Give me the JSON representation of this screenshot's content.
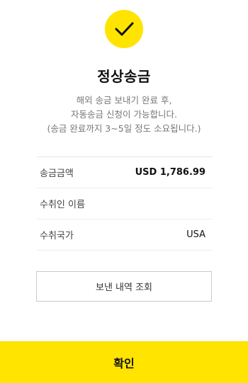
{
  "header": {
    "check_icon": "check-icon",
    "title": "정상송금",
    "description_lines": [
      "해외 송금 보내기 완료 후,",
      "자동송금 신청이 가능합니다.",
      "(송금 완료까지 3~5일 정도 소요됩니다.)"
    ]
  },
  "details": [
    {
      "label": "송금금액",
      "value": "USD 1,786.99"
    },
    {
      "label": "수취인 이름",
      "value": ""
    },
    {
      "label": "수취국가",
      "value": "USA"
    }
  ],
  "buttons": {
    "history_label": "보낸 내역 조회",
    "confirm_label": "확인"
  },
  "colors": {
    "accent": "#FFE400",
    "text_dark": "#111111",
    "text_muted": "#777777"
  }
}
